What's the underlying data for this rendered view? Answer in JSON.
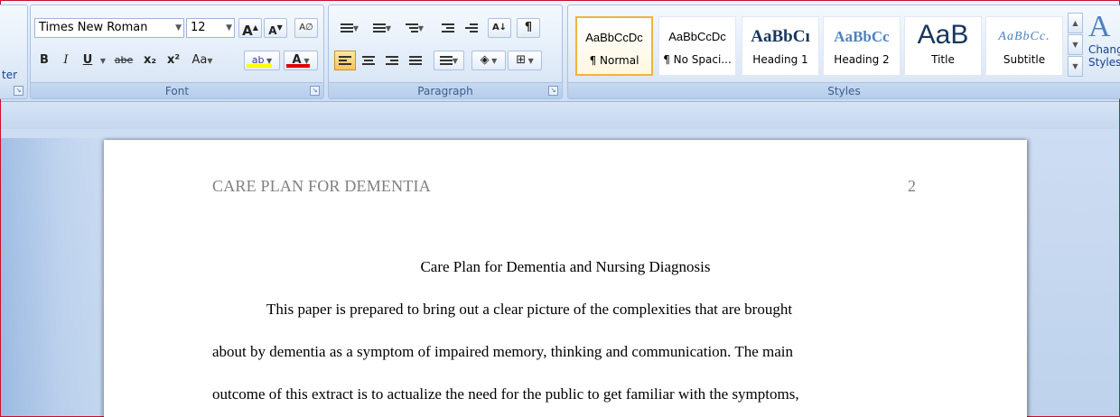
{
  "ribbon": {
    "clipboard": {
      "partial_label": "ter"
    },
    "font": {
      "label": "Font",
      "font_name": "Times New Roman",
      "font_size": "12",
      "grow": "A",
      "shrink": "A",
      "clear_format": "A∅",
      "bold": "B",
      "italic": "I",
      "underline": "U",
      "strike": "abe",
      "subscript": "x₂",
      "superscript": "x²",
      "change_case": "Aa",
      "highlight": "ab",
      "font_color": "A"
    },
    "paragraph": {
      "label": "Paragraph",
      "sort": "A↓",
      "pilcrow": "¶"
    },
    "styles": {
      "label": "Styles",
      "items": [
        {
          "sample": "AaBbCcDc",
          "name": "¶ Normal",
          "selected": true
        },
        {
          "sample": "AaBbCcDc",
          "name": "¶ No Spaci...",
          "selected": false
        },
        {
          "sample": "AaBbCı",
          "name": "Heading 1",
          "selected": false
        },
        {
          "sample": "AaBbCc",
          "name": "Heading 2",
          "selected": false
        },
        {
          "sample": "AaB",
          "name": "Title",
          "selected": false
        },
        {
          "sample": "AaBbCc.",
          "name": "Subtitle",
          "selected": false
        }
      ],
      "change_styles_icon": "A",
      "change_styles_line1": "Chang",
      "change_styles_line2": "Styles"
    }
  },
  "document": {
    "header": "CARE PLAN FOR DEMENTIA",
    "page_number": "2",
    "title": "Care Plan for Dementia and Nursing Diagnosis",
    "lines": [
      "This paper is prepared to bring out a clear picture of the complexities that are brought",
      "about by dementia as a symptom of impaired memory, thinking and communication.  The main",
      "outcome of this extract is to actualize the need for the public to get familiar with the symptoms,"
    ]
  },
  "colors": {
    "highlight": "#ffff00",
    "font_color": "#e00000",
    "selected_style_border": "#f0b43c",
    "frame": "#c8102e"
  }
}
